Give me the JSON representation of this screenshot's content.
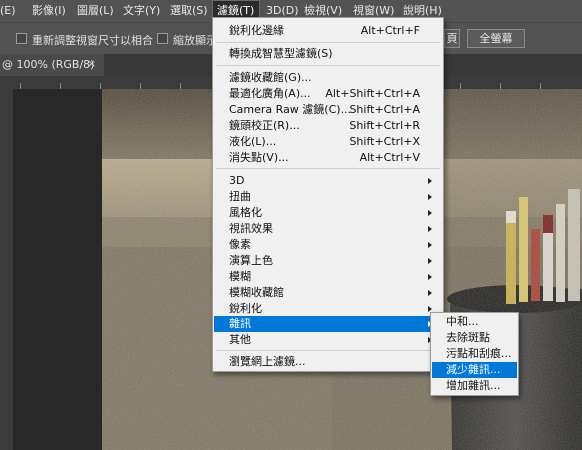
{
  "menubar": {
    "items": [
      "(E)",
      "影像(I)",
      "圖層(L)",
      "文字(Y)",
      "選取(S)",
      "濾鏡(T)",
      "3D(D)",
      "檢視(V)",
      "視窗(W)",
      "說明(H)"
    ]
  },
  "options": {
    "resize_windows_label": "重新調整視窗尺寸以相合",
    "zoom_all_label": "縮放顯示",
    "fit_button": "頁",
    "fullscreen_button": "全螢幕"
  },
  "document": {
    "tab_title": "@ 100% (RGB/8)",
    "close_glyph": "×"
  },
  "filter_menu": {
    "items": [
      {
        "label": "銳利化邊緣",
        "shortcut": "Alt+Ctrl+F"
      },
      {
        "label": "轉換成智慧型濾鏡(S)",
        "shortcut": ""
      },
      {
        "label": "濾鏡收藏館(G)...",
        "shortcut": ""
      },
      {
        "label": "最適化廣角(A)...",
        "shortcut": "Alt+Shift+Ctrl+A"
      },
      {
        "label": "Camera Raw 濾鏡(C)...",
        "shortcut": "Shift+Ctrl+A"
      },
      {
        "label": "鏡頭校正(R)...",
        "shortcut": "Shift+Ctrl+R"
      },
      {
        "label": "液化(L)...",
        "shortcut": "Shift+Ctrl+X"
      },
      {
        "label": "消失點(V)...",
        "shortcut": "Alt+Ctrl+V"
      },
      {
        "label": "3D",
        "shortcut": ""
      },
      {
        "label": "扭曲",
        "shortcut": ""
      },
      {
        "label": "風格化",
        "shortcut": ""
      },
      {
        "label": "視訊效果",
        "shortcut": ""
      },
      {
        "label": "像素",
        "shortcut": ""
      },
      {
        "label": "演算上色",
        "shortcut": ""
      },
      {
        "label": "模糊",
        "shortcut": ""
      },
      {
        "label": "模糊收藏館",
        "shortcut": ""
      },
      {
        "label": "銳利化",
        "shortcut": ""
      },
      {
        "label": "雜訊",
        "shortcut": ""
      },
      {
        "label": "其他",
        "shortcut": ""
      },
      {
        "label": "瀏覽網上濾鏡...",
        "shortcut": ""
      }
    ]
  },
  "noise_submenu": {
    "items": [
      "中和...",
      "去除斑點",
      "污點和刮痕...",
      "減少雜訊...",
      "增加雜訊..."
    ]
  },
  "colors": {
    "highlight": "#0078d7",
    "menubar_bg": "#535353",
    "menu_bg": "#f0f0f0"
  }
}
